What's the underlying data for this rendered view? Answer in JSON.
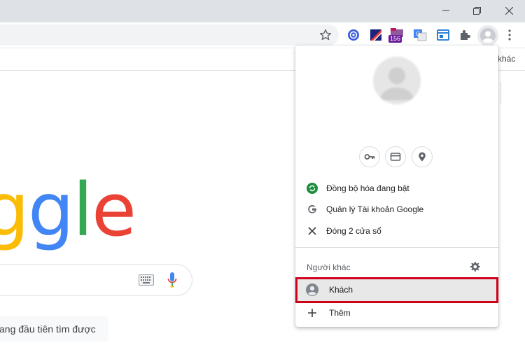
{
  "toolbar": {
    "extension_badge": "156"
  },
  "bookmarks": {
    "more_label": "khác"
  },
  "google": {
    "logo_letters": [
      {
        "ch": "g",
        "color": "#fbbc05"
      },
      {
        "ch": "g",
        "color": "#4285f4"
      },
      {
        "ch": "l",
        "color": "#34a853"
      },
      {
        "ch": "e",
        "color": "#ea4335"
      }
    ],
    "lucky_button_label": "ang đầu tiên tìm được"
  },
  "profile_menu": {
    "sync_label": "Đồng bộ hóa đang bật",
    "manage_account_label": "Quản lý Tài khoản Google",
    "close_windows_label": "Đóng 2 cửa sổ",
    "other_people_label": "Người khác",
    "guest_label": "Khách",
    "add_label": "Thêm",
    "highlight_color": "#d0021b"
  }
}
